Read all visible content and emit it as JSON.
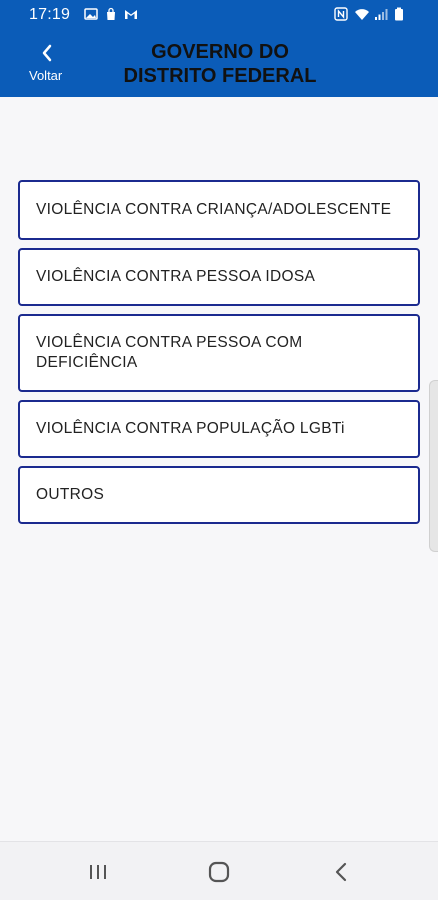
{
  "status_bar": {
    "time": "17:19",
    "left_icons": [
      "image-icon",
      "shopping-bag-icon",
      "gmail-icon"
    ],
    "right_icons": [
      "nfc-icon",
      "wifi-icon",
      "signal-icon",
      "battery-icon"
    ]
  },
  "header": {
    "back_label": "Voltar",
    "title": "GOVERNO DO\nDISTRITO FEDERAL",
    "background_color": "#0b5cb8"
  },
  "options": [
    {
      "label": "VIOLÊNCIA CONTRA CRIANÇA/ADOLESCENTE"
    },
    {
      "label": "VIOLÊNCIA CONTRA PESSOA IDOSA"
    },
    {
      "label": "VIOLÊNCIA CONTRA PESSOA COM DEFICIÊNCIA"
    },
    {
      "label": "VIOLÊNCIA CONTRA POPULAÇÃO LGBTi"
    },
    {
      "label": "OUTROS"
    }
  ],
  "nav_bar": {
    "buttons": [
      "recent-apps-icon",
      "home-icon",
      "back-icon"
    ]
  },
  "colors": {
    "accent": "#0b5cb8",
    "option_border": "#1b2a8f"
  }
}
